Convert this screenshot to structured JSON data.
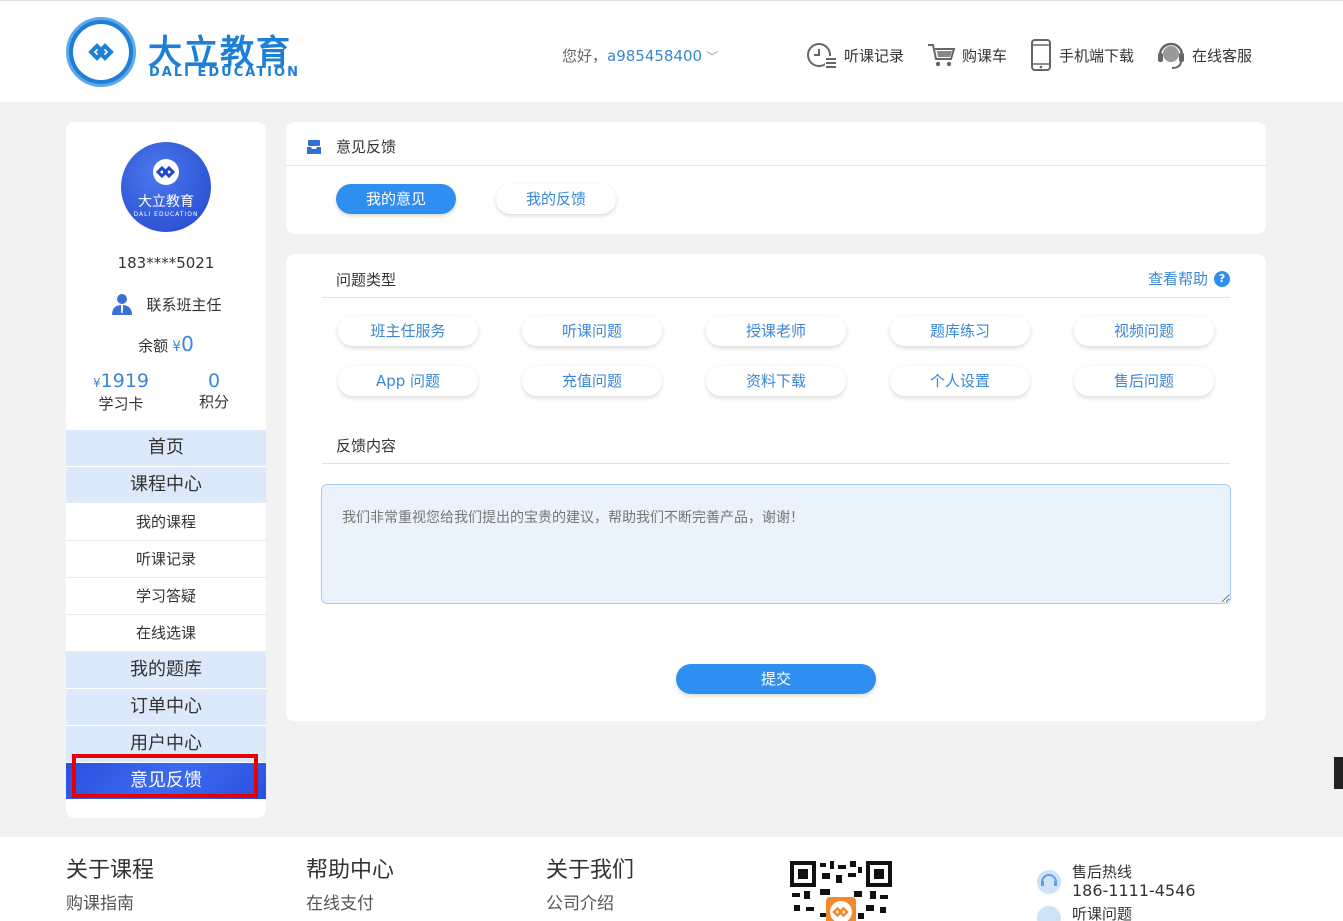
{
  "header": {
    "logo_cn": "大立教育",
    "logo_en": "DALI EDUCATION",
    "greeting": "您好，",
    "username": "a985458400",
    "links": [
      {
        "label": "听课记录",
        "icon": "history-icon"
      },
      {
        "label": "购课车",
        "icon": "cart-icon"
      },
      {
        "label": "手机端下载",
        "icon": "phone-icon"
      },
      {
        "label": "在线客服",
        "icon": "headset-icon"
      }
    ]
  },
  "sidebar": {
    "avatar_cn": "大立教育",
    "avatar_en": "DALI EDUCATION",
    "phone": "183****5021",
    "contact": "联系班主任",
    "balance_label": "余额",
    "balance_currency": "¥",
    "balance_value": "0",
    "card_currency": "¥",
    "card_value": "1919",
    "card_label": "学习卡",
    "points_value": "0",
    "points_label": "积分",
    "nav": [
      {
        "label": "首页",
        "type": "main"
      },
      {
        "label": "课程中心",
        "type": "main"
      },
      {
        "label": "我的课程",
        "type": "sub"
      },
      {
        "label": "听课记录",
        "type": "sub"
      },
      {
        "label": "学习答疑",
        "type": "sub"
      },
      {
        "label": "在线选课",
        "type": "sub"
      },
      {
        "label": "我的题库",
        "type": "main"
      },
      {
        "label": "订单中心",
        "type": "main"
      },
      {
        "label": "用户中心",
        "type": "main"
      },
      {
        "label": "意见反馈",
        "type": "active"
      }
    ]
  },
  "feedback": {
    "title": "意见反馈",
    "tabs": [
      "我的意见",
      "我的反馈"
    ],
    "type_title": "问题类型",
    "help": "查看帮助",
    "help_icon": "?",
    "types": [
      "班主任服务",
      "听课问题",
      "授课老师",
      "题库练习",
      "视频问题",
      "App 问题",
      "充值问题",
      "资料下载",
      "个人设置",
      "售后问题"
    ],
    "content_title": "反馈内容",
    "placeholder": "我们非常重视您给我们提出的宝贵的建议，帮助我们不断完善产品，谢谢！",
    "submit": "提交"
  },
  "footer": {
    "cols": [
      {
        "title": "关于课程",
        "link": "购课指南"
      },
      {
        "title": "帮助中心",
        "link": "在线支付"
      },
      {
        "title": "关于我们",
        "link": "公司介绍"
      }
    ],
    "hotline_label": "售后热线",
    "hotline_number": "186-1111-4546",
    "hotline2_label": "听课问题"
  },
  "colors": {
    "accent": "#2f8ff0",
    "brand": "#1e7fd6",
    "highlight": "#e80000"
  }
}
